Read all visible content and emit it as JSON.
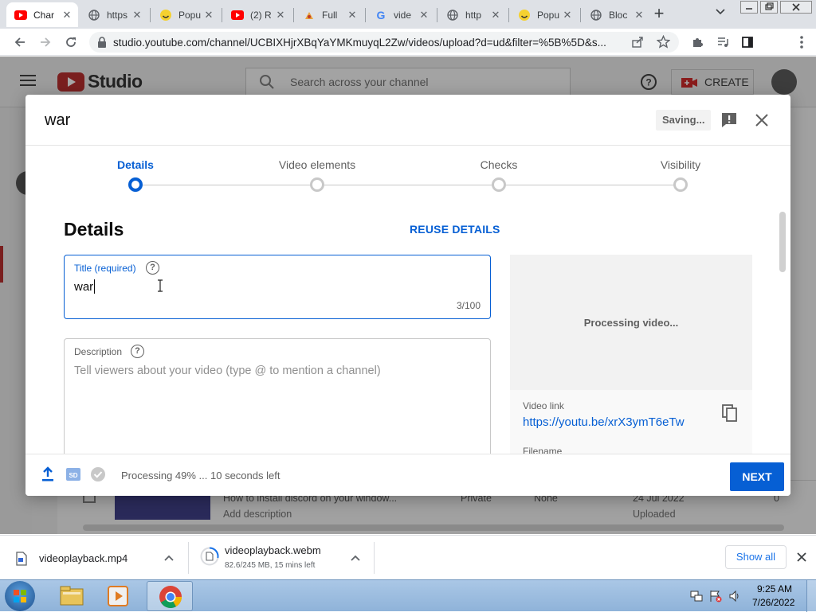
{
  "browser": {
    "tabs": [
      {
        "label": "Char",
        "icon": "youtube-icon",
        "active": true
      },
      {
        "label": "https",
        "icon": "globe-icon"
      },
      {
        "label": "Popu",
        "icon": "smiley-icon"
      },
      {
        "label": "(2) R",
        "icon": "youtube-icon"
      },
      {
        "label": "Full",
        "icon": "file-icon"
      },
      {
        "label": "vide",
        "icon": "google-icon"
      },
      {
        "label": "http",
        "icon": "globe-icon"
      },
      {
        "label": "Popu",
        "icon": "smiley-icon"
      },
      {
        "label": "Bloc",
        "icon": "globe-icon"
      }
    ],
    "url": "studio.youtube.com/channel/UCBIXHjrXBqYaYMKmuyqL2Zw/videos/upload?d=ud&filter=%5B%5D&s..."
  },
  "studio": {
    "logo_text": "Studio",
    "search_placeholder": "Search across your channel",
    "create_label": "CREATE",
    "bg_row": {
      "title": "How to install discord on your window...",
      "subtitle": "Add description",
      "visibility": "Private",
      "restrictions": "None",
      "date": "24 Jul 2022",
      "date_status": "Uploaded",
      "views": "0"
    }
  },
  "modal": {
    "title": "war",
    "saving_label": "Saving...",
    "steps": [
      "Details",
      "Video elements",
      "Checks",
      "Visibility"
    ],
    "active_step": 0,
    "section_heading": "Details",
    "reuse_label": "REUSE DETAILS",
    "title_field": {
      "label": "Title (required)",
      "value": "war",
      "counter": "3/100"
    },
    "description_field": {
      "label": "Description",
      "placeholder": "Tell viewers about your video (type @ to mention a channel)"
    },
    "preview_text": "Processing video...",
    "video_link_label": "Video link",
    "video_link": "https://youtu.be/xrX3ymT6eTw",
    "filename_label": "Filename",
    "footer_status": "Processing 49% ... 10 seconds left",
    "next_label": "NEXT"
  },
  "downloads": [
    {
      "name": "videoplayback.mp4",
      "detail": ""
    },
    {
      "name": "videoplayback.webm",
      "detail": "82.6/245 MB, 15 mins left"
    }
  ],
  "downloads_show_all": "Show all",
  "taskbar": {
    "time": "9:25 AM",
    "date": "7/26/2022"
  },
  "colors": {
    "accent": "#065fd4",
    "youtube_red": "#ff0000",
    "next_button": "#065fd4"
  }
}
